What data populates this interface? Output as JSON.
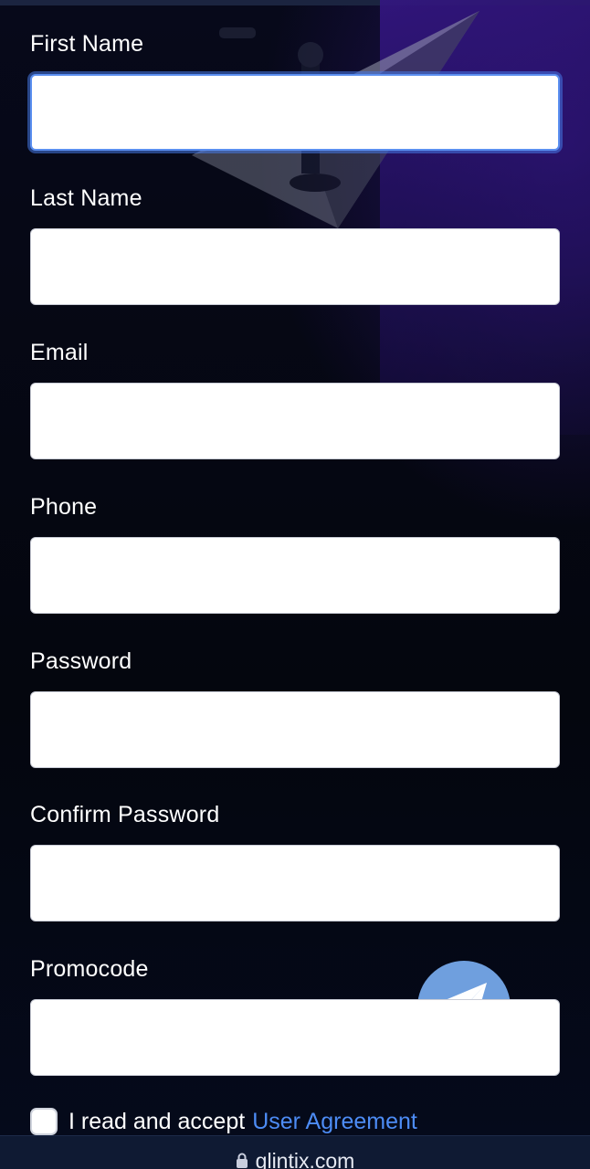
{
  "form": {
    "fields": [
      {
        "label": "First Name",
        "value": "",
        "placeholder": ""
      },
      {
        "label": "Last Name",
        "value": "",
        "placeholder": ""
      },
      {
        "label": "Email",
        "value": "",
        "placeholder": ""
      },
      {
        "label": "Phone",
        "value": "",
        "placeholder": ""
      },
      {
        "label": "Password",
        "value": "",
        "placeholder": ""
      },
      {
        "label": "Confirm Password",
        "value": "",
        "placeholder": ""
      },
      {
        "label": "Promocode",
        "value": "",
        "placeholder": ""
      }
    ],
    "agreement": {
      "text": "I read and accept",
      "link_label": "User Agreement",
      "checked": false
    }
  },
  "browser": {
    "url": "glintix.com"
  },
  "icons": {
    "fab": "telegram-icon",
    "url_lock": "lock-icon"
  },
  "colors": {
    "link": "#4d8cf5",
    "fab": "#6f9fde",
    "focus_ring": "#5b8ff0",
    "background": "#04060d",
    "accent_purple": "#34168a"
  }
}
